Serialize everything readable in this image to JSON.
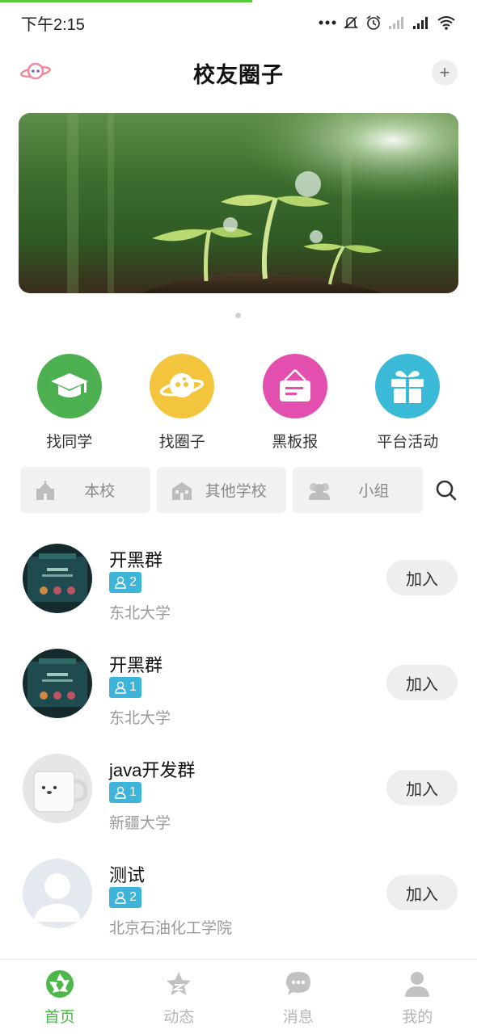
{
  "status_bar": {
    "time": "下午2:15",
    "icons": [
      "more-dots-icon",
      "mute-icon",
      "alarm-icon",
      "signal-icon",
      "signal-icon",
      "wifi-icon"
    ]
  },
  "header": {
    "title": "校友圈子",
    "add_symbol": "+",
    "logo_icon": "planet-logo-icon"
  },
  "banner": {
    "image": "sprouts-photo"
  },
  "quick_entries": [
    {
      "label": "找同学",
      "icon": "graduation-cap-icon",
      "color": "#4cb050"
    },
    {
      "label": "找圈子",
      "icon": "planet-icon",
      "color": "#f2c53d"
    },
    {
      "label": "黑板报",
      "icon": "hanging-board-icon",
      "color": "#e34fae"
    },
    {
      "label": "平台活动",
      "icon": "gift-icon",
      "color": "#3bbad8"
    }
  ],
  "filters": [
    {
      "label": "本校",
      "icon": "school-icon"
    },
    {
      "label": "其他学校",
      "icon": "building-icon"
    },
    {
      "label": "小组",
      "icon": "group-icon"
    }
  ],
  "groups": [
    {
      "name": "开黑群",
      "members": "2",
      "school": "东北大学",
      "action": "加入",
      "avatar": "game-screenshot"
    },
    {
      "name": "开黑群",
      "members": "1",
      "school": "东北大学",
      "action": "加入",
      "avatar": "game-screenshot"
    },
    {
      "name": "java开发群",
      "members": "1",
      "school": "新疆大学",
      "action": "加入",
      "avatar": "mug-photo"
    },
    {
      "name": "测试",
      "members": "2",
      "school": "北京石油化工学院",
      "action": "加入",
      "avatar": "default-user"
    }
  ],
  "tabbar": [
    {
      "label": "首页",
      "icon": "home-aperture-icon",
      "active": true
    },
    {
      "label": "动态",
      "icon": "star-icon",
      "active": false
    },
    {
      "label": "消息",
      "icon": "chat-bubble-icon",
      "active": false
    },
    {
      "label": "我的",
      "icon": "person-icon",
      "active": false
    }
  ],
  "colors": {
    "accent_green": "#4cb84a",
    "badge_blue": "#3db4d9",
    "inactive_gray": "#b5b5b5"
  }
}
